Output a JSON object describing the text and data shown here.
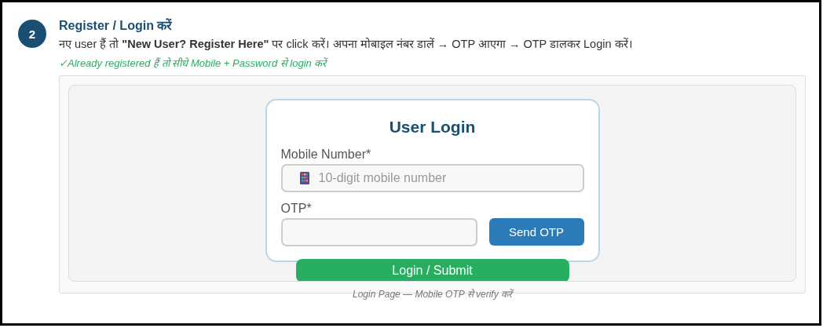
{
  "step": {
    "number": "2",
    "title": "Register / Login करें",
    "description": "नए user हैं तो **\"New User? Register Here\"** पर click करें। अपना मोबाइल नंबर डालें → OTP आएगा → OTP डालकर Login करें।",
    "note": "✓Already registered हैं तो सीधे Mobile + Password से login करें"
  },
  "login_card": {
    "title": "User Login",
    "fields": [
      {
        "label": "Mobile Number*",
        "placeholder": "10-digit mobile number"
      },
      {
        "label": "OTP*",
        "button": "Send OTP"
      }
    ],
    "submit": "Login / Submit"
  },
  "caption": "Login Page — Mobile OTP से verify करें"
}
